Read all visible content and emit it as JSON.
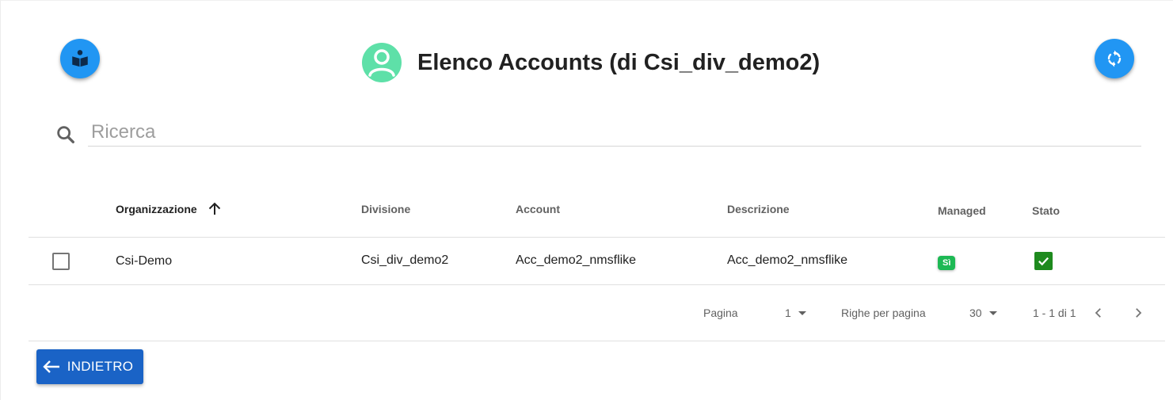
{
  "header": {
    "title": "Elenco Accounts (di Csi_div_demo2)",
    "left_icon": "book-reader-icon",
    "right_icon": "refresh-icon",
    "avatar_icon": "account-circle-icon"
  },
  "search": {
    "placeholder": "Ricerca",
    "value": ""
  },
  "table": {
    "columns": [
      "Organizzazione",
      "Divisione",
      "Account",
      "Descrizione",
      "Managed",
      "Stato"
    ],
    "sorted_column": "Organizzazione",
    "sort_direction": "ascending",
    "rows": [
      {
        "organizzazione": "Csi-Demo",
        "divisione": "Csi_div_demo2",
        "account": "Acc_demo2_nmsflike",
        "descrizione": "Acc_demo2_nmsflike",
        "managed": "Sì",
        "stato": "checked"
      }
    ]
  },
  "pagination": {
    "page_label": "Pagina",
    "page_value": "1",
    "rows_label": "Righe per pagina",
    "rows_value": "30",
    "range_text": "1 - 1 di 1"
  },
  "footer": {
    "back_label": "INDIETRO"
  },
  "colors": {
    "fab": "#2196f3",
    "avatar": "#5ee0a8",
    "back_button": "#1a63c6",
    "badge": "#1db954",
    "status": "#1e8a1e"
  }
}
